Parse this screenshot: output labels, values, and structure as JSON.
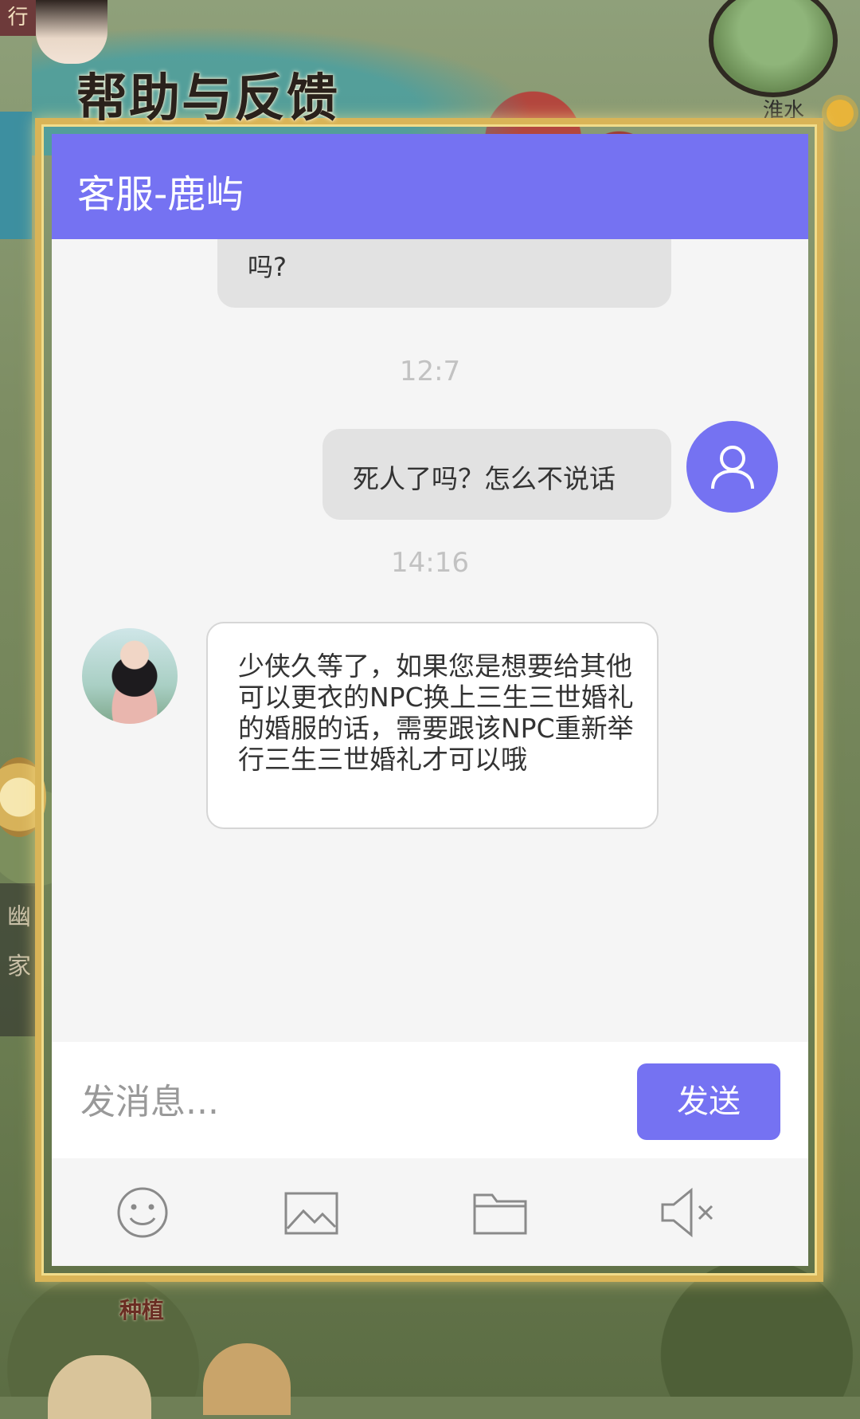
{
  "dialog": {
    "title": "帮助与反馈"
  },
  "chat": {
    "header_title": "客服-鹿屿",
    "messages": [
      {
        "from": "user",
        "text": "吗?"
      },
      {
        "time": "12:7"
      },
      {
        "from": "user",
        "text": "死人了吗？怎么不说话"
      },
      {
        "time": "14:16"
      },
      {
        "from": "agent",
        "text": "少侠久等了，如果您是想要给其他可以更衣的NPC换上三生三世婚礼的婚服的话，需要跟该NPC重新举行三生三世婚礼才可以哦"
      }
    ],
    "input": {
      "placeholder": "发消息...",
      "value": ""
    },
    "send_label": "发送",
    "toolbar": [
      "emoji-icon",
      "image-icon",
      "folder-icon",
      "mute-icon"
    ]
  },
  "background": {
    "side_tab": "行",
    "minimap_label": "淮水",
    "left_panel": [
      "幽",
      "家"
    ],
    "bottom_label": "种植"
  },
  "colors": {
    "accent": "#7572f2",
    "chat_bg": "#f5f5f5",
    "bubble_grey": "#e2e2e2",
    "frame_gold": "#d9b457"
  }
}
